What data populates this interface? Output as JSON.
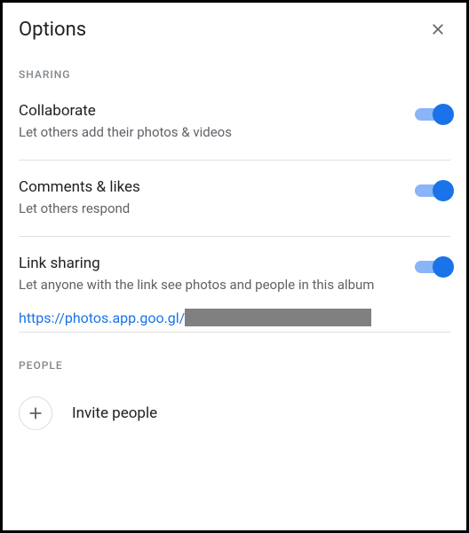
{
  "header": {
    "title": "Options"
  },
  "sections": {
    "sharing_label": "SHARING",
    "people_label": "PEOPLE"
  },
  "options": {
    "collaborate": {
      "title": "Collaborate",
      "desc": "Let others add their photos & videos",
      "on": true
    },
    "comments": {
      "title": "Comments & likes",
      "desc": "Let others respond",
      "on": true
    },
    "link_sharing": {
      "title": "Link sharing",
      "desc": "Let anyone with the link see photos and people in this album",
      "on": true
    }
  },
  "share_link": {
    "prefix": "https://photos.app.goo.gl/"
  },
  "invite": {
    "label": "Invite people"
  }
}
